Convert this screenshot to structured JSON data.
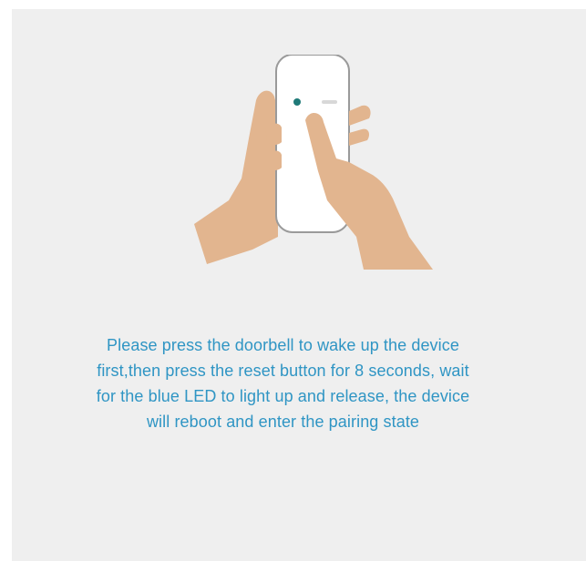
{
  "illustration": {
    "icon": "hand-pressing-doorbell-icon",
    "led_color": "#1f7a78",
    "skin_color": "#e2b58f",
    "device_color": "#ffffff"
  },
  "instruction": {
    "text": "Please press the doorbell to wake up the device first,then press the reset button for 8 seconds, wait for the blue LED to light up and release, the device will reboot and enter the pairing state"
  },
  "colors": {
    "background": "#efefef",
    "text_accent": "#2f95c4"
  }
}
